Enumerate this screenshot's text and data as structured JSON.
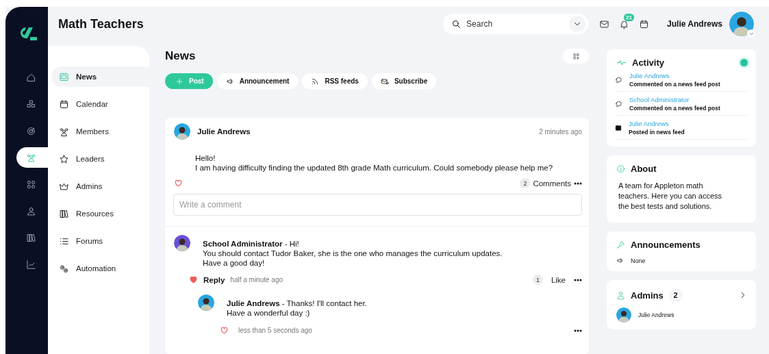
{
  "rail": {
    "items": [
      {
        "selected": false
      },
      {
        "selected": false
      },
      {
        "selected": false
      },
      {
        "selected": true
      },
      {
        "selected": false
      },
      {
        "selected": false
      },
      {
        "selected": false
      },
      {
        "selected": false
      }
    ]
  },
  "header": {
    "title": "Math Teachers",
    "search": {
      "placeholder": "Search"
    },
    "notifications_badge": "21",
    "user_name": "Julie Andrews"
  },
  "nav": {
    "items": [
      {
        "label": "News",
        "selected": true
      },
      {
        "label": "Calendar",
        "selected": false
      },
      {
        "label": "Members",
        "selected": false
      },
      {
        "label": "Leaders",
        "selected": false
      },
      {
        "label": "Admins",
        "selected": false
      },
      {
        "label": "Resources",
        "selected": false
      },
      {
        "label": "Forums",
        "selected": false
      },
      {
        "label": "Automation",
        "selected": false
      }
    ]
  },
  "main": {
    "title": "News",
    "actions": [
      {
        "label": "Post",
        "kind": "primary"
      },
      {
        "label": "Announcement",
        "kind": "secondary"
      },
      {
        "label": "RSS feeds",
        "kind": "secondary"
      },
      {
        "label": "Subscribe",
        "kind": "secondary"
      }
    ],
    "post": {
      "author": "Julie Andrews",
      "time": "2 minutes ago",
      "body": "Hello!\nI am having difficulty finding the updated 8th grade Math curriculum. Could somebody please help me?",
      "liked": false,
      "comment_count": "2",
      "comments_label": "Comments",
      "comment_field": {
        "placeholder": "Write a comment"
      },
      "comments": [
        {
          "text": "**School Administrator** - Hi!\nYou should contact Tudor Baker, she is the one who manages the curriculum updates.\nHave a good day!",
          "liked": true,
          "reply_label": "Reply",
          "time": "half a minute ago",
          "like_count": "1",
          "like_label": "Like",
          "replies": [
            {
              "text": "**Julie Andrews** - Thanks! I'll contact her.\nHave a wonderful day :)",
              "liked": false,
              "time": "less than 5 seconds ago"
            }
          ]
        }
      ]
    }
  },
  "activity": {
    "title": "Activity",
    "items": [
      {
        "kind": "comment",
        "name": "Julie Andrews",
        "action": "Commented on a news feed post"
      },
      {
        "kind": "comment",
        "name": "School Administrator",
        "action": "Commented on a news feed post"
      },
      {
        "kind": "post",
        "name": "Julie Andrews",
        "action": "Posted in news feed"
      }
    ]
  },
  "about": {
    "title": "About",
    "text": "A team for Appleton math teachers. Here you can access the best tests and solutions."
  },
  "announcements": {
    "title": "Announcements",
    "items": [
      "None"
    ]
  },
  "admins": {
    "title": "Admins",
    "count": "2",
    "items": [
      "Julie Andrews"
    ]
  }
}
